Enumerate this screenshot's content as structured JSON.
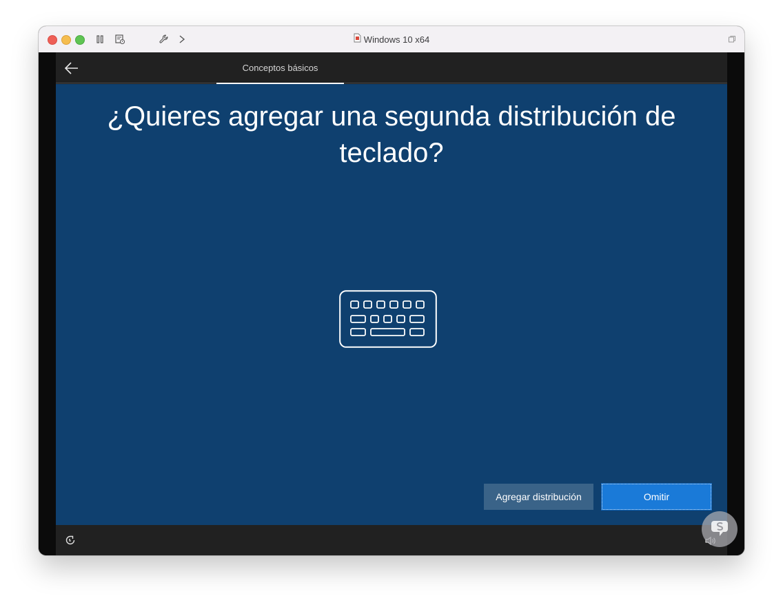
{
  "window": {
    "title": "Windows 10 x64"
  },
  "topbar": {
    "tab_label": "Conceptos básicos"
  },
  "main": {
    "heading": "¿Quieres agregar una segunda distribución de teclado?"
  },
  "buttons": {
    "add_label": "Agregar distribución",
    "skip_label": "Omitir"
  },
  "colors": {
    "background_blue": "#0f406f",
    "primary_button": "#1a7ad8",
    "secondary_button": "#3a6388",
    "bar_dark": "#212121"
  },
  "icons": {
    "back": "back-arrow-icon",
    "keyboard": "keyboard-icon",
    "ease_of_access": "ease-of-access-icon",
    "volume": "volume-icon"
  }
}
